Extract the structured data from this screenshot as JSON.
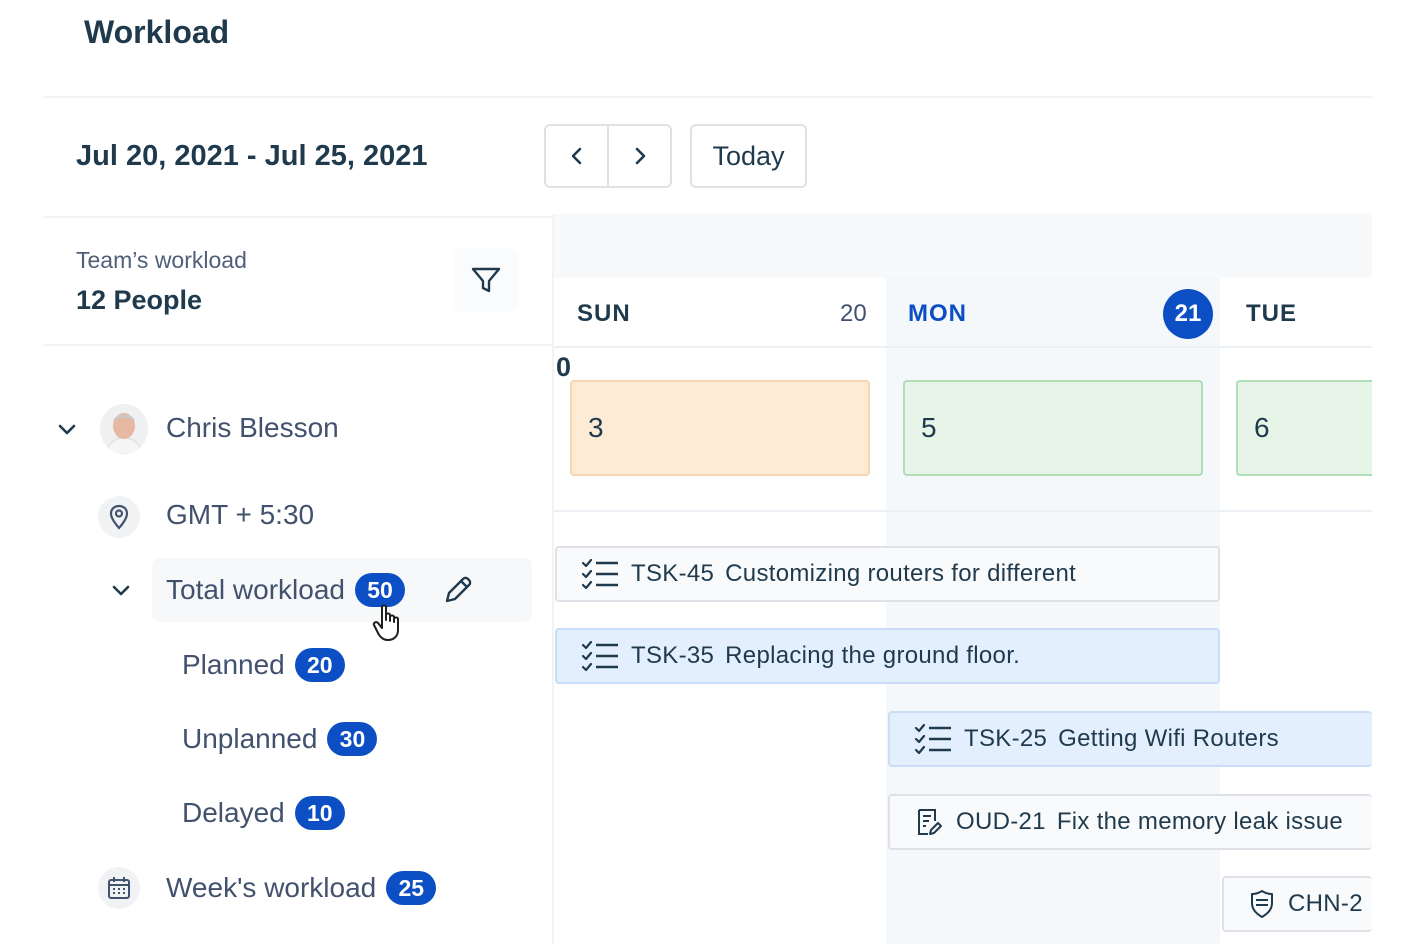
{
  "page": {
    "title": "Workload"
  },
  "header": {
    "date_range": "Jul 20, 2021 - Jul 25, 2021",
    "today_label": "Today"
  },
  "team": {
    "label": "Team’s workload",
    "people": "12 People"
  },
  "person": {
    "name": "Chris Blesson",
    "timezone": "GMT + 5:30",
    "total": {
      "label": "Total workload",
      "count": "50"
    },
    "planned": {
      "label": "Planned",
      "count": "20"
    },
    "unplanned": {
      "label": "Unplanned",
      "count": "30"
    },
    "delayed": {
      "label": "Delayed",
      "count": "10"
    },
    "week": {
      "label": "Week's workload",
      "count": "25"
    }
  },
  "calendar": {
    "days": [
      {
        "name": "SUN",
        "date": "20"
      },
      {
        "name": "MON",
        "date": "21"
      },
      {
        "name": "TUE",
        "date": ""
      }
    ],
    "zero_label": "0",
    "capacity": [
      "3",
      "5",
      "6"
    ],
    "tasks": [
      {
        "key": "TSK-45",
        "title": "Customizing routers for different",
        "icon": "checklist-icon"
      },
      {
        "key": "TSK-35",
        "title": "Replacing the ground floor.",
        "icon": "checklist-icon"
      },
      {
        "key": "TSK-25",
        "title": "Getting Wifi Routers",
        "icon": "checklist-icon"
      },
      {
        "key": "OUD-21",
        "title": "Fix the memory leak issue",
        "icon": "document-edit-icon"
      },
      {
        "key": "CHN-2",
        "title": "",
        "icon": "shield-icon"
      }
    ]
  },
  "colors": {
    "accent": "#0c4fc4",
    "capacity_over": "#fdebd6",
    "capacity_ok": "#e6f5e8",
    "task_selected": "#e4effd"
  }
}
